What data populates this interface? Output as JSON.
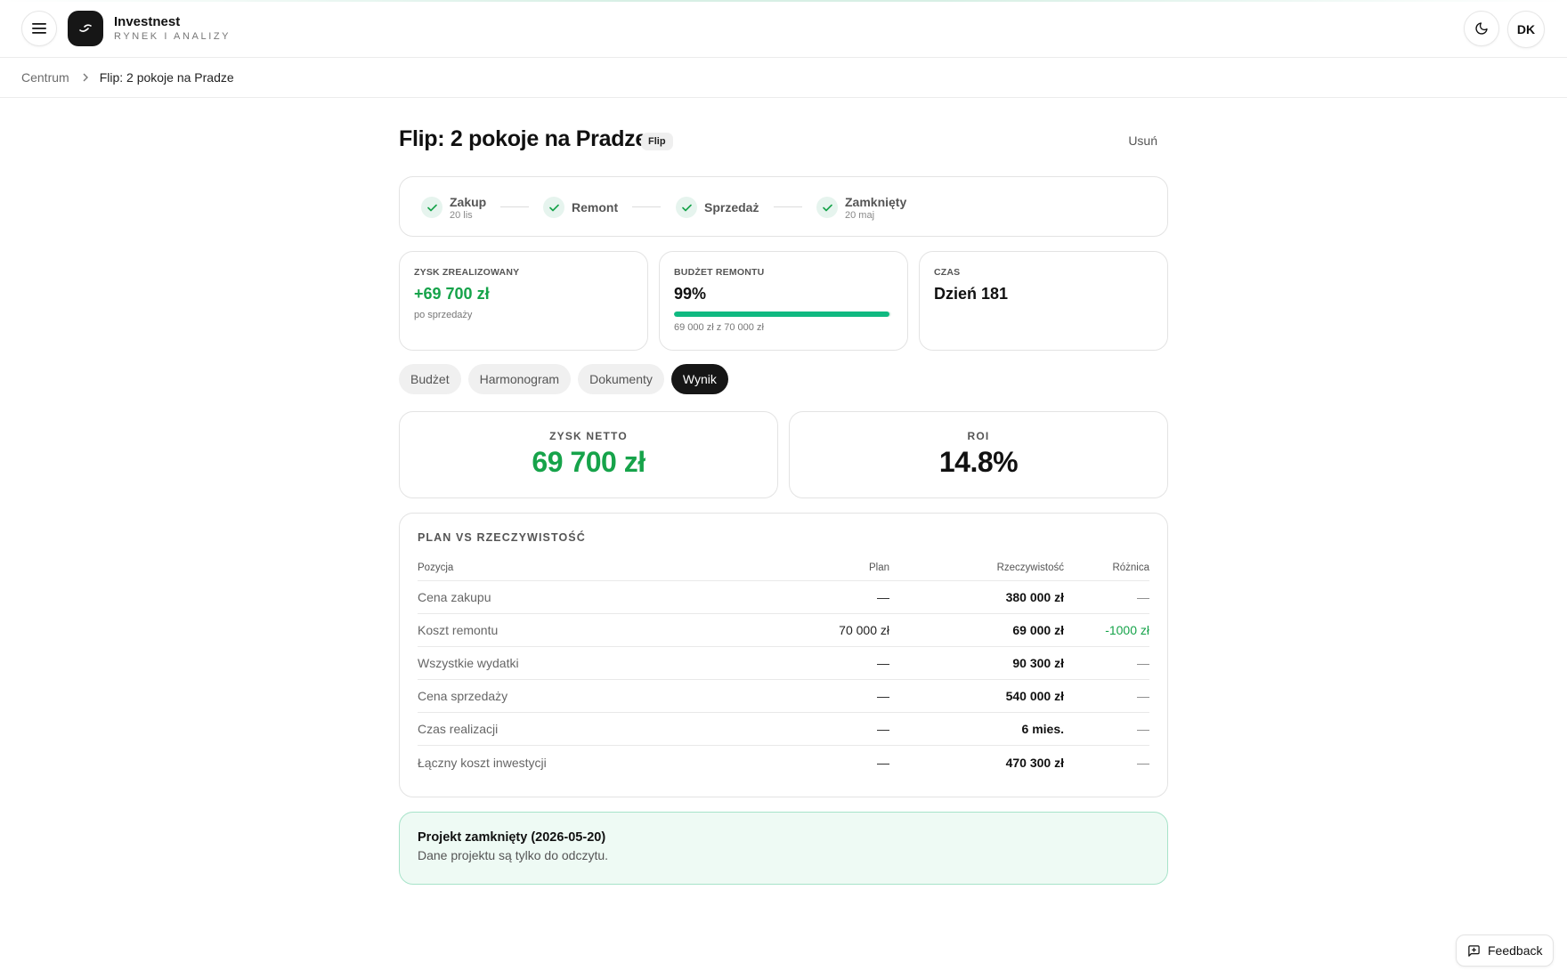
{
  "app": {
    "name": "Investnest",
    "subtitle": "RYNEK I ANALIZY",
    "user_initials": "DK"
  },
  "breadcrumb": {
    "root": "Centrum",
    "current": "Flip: 2 pokoje na Pradze"
  },
  "project": {
    "title": "Flip: 2 pokoje na Pradze",
    "type_badge": "Flip",
    "delete_label": "Usuń"
  },
  "stepper": {
    "steps": [
      {
        "label": "Zakup",
        "date": "20 lis",
        "done": true
      },
      {
        "label": "Remont",
        "date": "",
        "done": true
      },
      {
        "label": "Sprzedaż",
        "date": "",
        "done": true
      },
      {
        "label": "Zamknięty",
        "date": "20 maj",
        "done": true
      }
    ]
  },
  "stats": {
    "profit": {
      "label": "ZYSK ZREALIZOWANY",
      "value": "+69 700 zł",
      "sub": "po sprzedaży"
    },
    "budget": {
      "label": "BUDŻET REMONTU",
      "value": "99%",
      "progress_pct": 99,
      "sub": "69 000 zł z 70 000 zł"
    },
    "time": {
      "label": "CZAS",
      "value": "Dzień 181"
    }
  },
  "tabs": [
    {
      "label": "Budżet",
      "active": false
    },
    {
      "label": "Harmonogram",
      "active": false
    },
    {
      "label": "Dokumenty",
      "active": false
    },
    {
      "label": "Wynik",
      "active": true
    }
  ],
  "kpis": {
    "net_profit": {
      "label": "ZYSK NETTO",
      "value": "69 700 zł"
    },
    "roi": {
      "label": "ROI",
      "value": "14.8%"
    }
  },
  "plan_table": {
    "heading": "PLAN VS RZECZYWISTOŚĆ",
    "columns": [
      "Pozycja",
      "Plan",
      "Rzeczywistość",
      "Różnica"
    ],
    "rows": [
      {
        "item": "Cena zakupu",
        "plan": "—",
        "actual": "380 000 zł",
        "diff": "—"
      },
      {
        "item": "Koszt remontu",
        "plan": "70 000 zł",
        "actual": "69 000 zł",
        "diff": "-1000 zł"
      },
      {
        "item": "Wszystkie wydatki",
        "plan": "—",
        "actual": "90 300 zł",
        "diff": "—"
      },
      {
        "item": "Cena sprzedaży",
        "plan": "—",
        "actual": "540 000 zł",
        "diff": "—"
      },
      {
        "item": "Czas realizacji",
        "plan": "—",
        "actual": "6 mies.",
        "diff": "—"
      },
      {
        "item": "Łączny koszt inwestycji",
        "plan": "—",
        "actual": "470 300 zł",
        "diff": "—"
      }
    ]
  },
  "closed_banner": {
    "title": "Projekt zamknięty (2026-05-20)",
    "text": "Dane projektu są tylko do odczytu."
  },
  "feedback": {
    "label": "Feedback"
  },
  "colors": {
    "accent_green": "#16a34a",
    "progress_green": "#10b981",
    "dark": "#161616",
    "banner_bg": "#eefaf4"
  },
  "icons": {
    "menu": "menu-icon",
    "logo": "logo-icon",
    "theme": "moon-icon",
    "breadcrumb_separator": "chevron-right-icon",
    "step_done": "check-icon",
    "feedback": "message-square-icon"
  }
}
